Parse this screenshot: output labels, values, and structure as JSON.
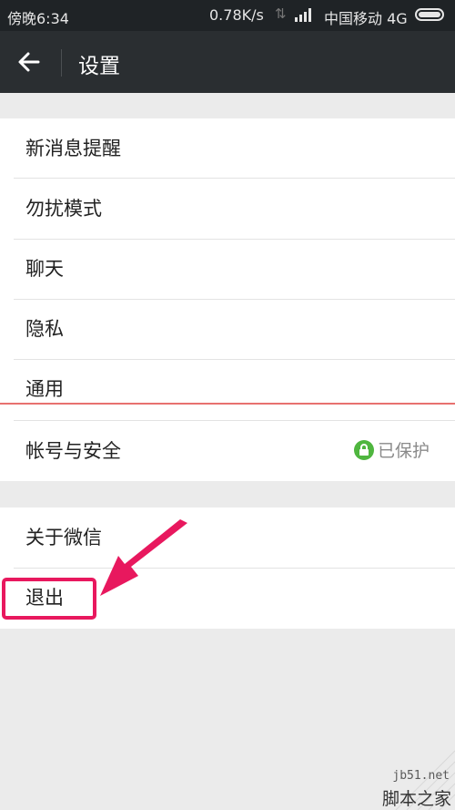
{
  "status_bar": {
    "carrier_left": "傍晚6:34",
    "speed": "0.78K/s",
    "carrier": "中国移动 4G"
  },
  "header": {
    "title": "设置",
    "back_icon": "back-arrow-icon"
  },
  "menu": {
    "group1": [
      {
        "label": "新消息提醒"
      },
      {
        "label": "勿扰模式"
      },
      {
        "label": "聊天"
      },
      {
        "label": "隐私"
      },
      {
        "label": "通用"
      },
      {
        "label": "帐号与安全",
        "status": "已保护"
      }
    ],
    "group2": [
      {
        "label": "关于微信"
      },
      {
        "label": "退出"
      }
    ]
  },
  "watermark": {
    "url": "jb51.net",
    "name": "脚本之家"
  },
  "colors": {
    "accent_pink": "#e8185e",
    "protect_green": "#4fb63f",
    "red_line": "#e8716f"
  }
}
